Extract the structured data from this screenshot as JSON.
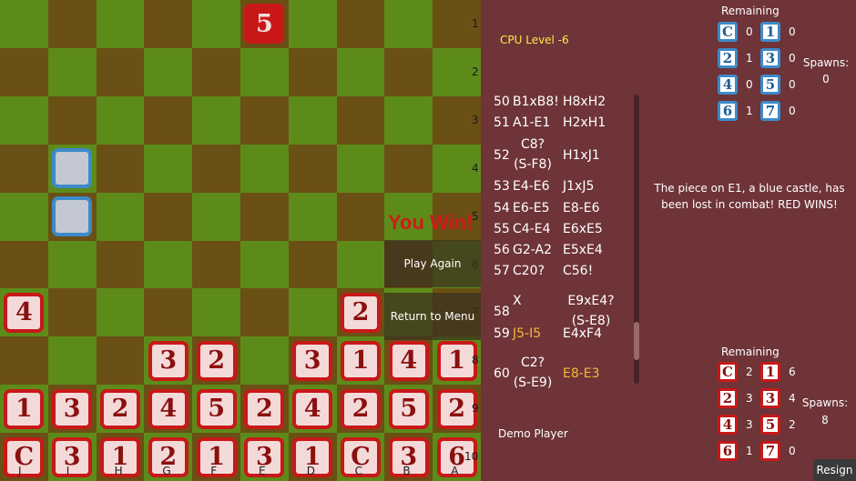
{
  "board": {
    "row_labels": [
      "1",
      "2",
      "3",
      "4",
      "5",
      "6",
      "7",
      "8",
      "9",
      "10"
    ],
    "col_labels": [
      "J",
      "I",
      "H",
      "G",
      "F",
      "E",
      "D",
      "C",
      "B",
      "A"
    ],
    "pieces": [
      {
        "col": 5,
        "row": 0,
        "label": "5",
        "style": "sel"
      },
      {
        "col": 1,
        "row": 3,
        "label": "",
        "style": "blue-empty"
      },
      {
        "col": 1,
        "row": 4,
        "label": "",
        "style": "blue-empty"
      },
      {
        "col": 0,
        "row": 6,
        "label": "4",
        "style": "red"
      },
      {
        "col": 7,
        "row": 6,
        "label": "2",
        "style": "red"
      },
      {
        "col": 3,
        "row": 7,
        "label": "3",
        "style": "red"
      },
      {
        "col": 4,
        "row": 7,
        "label": "2",
        "style": "red"
      },
      {
        "col": 6,
        "row": 7,
        "label": "3",
        "style": "red"
      },
      {
        "col": 7,
        "row": 7,
        "label": "1",
        "style": "red"
      },
      {
        "col": 8,
        "row": 7,
        "label": "4",
        "style": "red"
      },
      {
        "col": 9,
        "row": 7,
        "label": "1",
        "style": "red"
      },
      {
        "col": 0,
        "row": 8,
        "label": "1",
        "style": "red"
      },
      {
        "col": 1,
        "row": 8,
        "label": "3",
        "style": "red"
      },
      {
        "col": 2,
        "row": 8,
        "label": "2",
        "style": "red"
      },
      {
        "col": 3,
        "row": 8,
        "label": "4",
        "style": "red"
      },
      {
        "col": 4,
        "row": 8,
        "label": "5",
        "style": "red"
      },
      {
        "col": 5,
        "row": 8,
        "label": "2",
        "style": "red"
      },
      {
        "col": 6,
        "row": 8,
        "label": "4",
        "style": "red"
      },
      {
        "col": 7,
        "row": 8,
        "label": "2",
        "style": "red"
      },
      {
        "col": 8,
        "row": 8,
        "label": "5",
        "style": "red"
      },
      {
        "col": 9,
        "row": 8,
        "label": "2",
        "style": "red"
      },
      {
        "col": 0,
        "row": 9,
        "label": "C",
        "style": "red"
      },
      {
        "col": 1,
        "row": 9,
        "label": "3",
        "style": "red"
      },
      {
        "col": 2,
        "row": 9,
        "label": "1",
        "style": "red"
      },
      {
        "col": 3,
        "row": 9,
        "label": "2",
        "style": "red"
      },
      {
        "col": 4,
        "row": 9,
        "label": "1",
        "style": "red"
      },
      {
        "col": 5,
        "row": 9,
        "label": "3",
        "style": "red"
      },
      {
        "col": 6,
        "row": 9,
        "label": "1",
        "style": "red"
      },
      {
        "col": 7,
        "row": 9,
        "label": "C",
        "style": "red"
      },
      {
        "col": 8,
        "row": 9,
        "label": "3",
        "style": "red"
      },
      {
        "col": 9,
        "row": 9,
        "label": "6",
        "style": "red"
      }
    ]
  },
  "overlay": {
    "you_win": "You Win!",
    "play_again": "Play Again",
    "return_to_menu": "Return to Menu"
  },
  "left_panel": {
    "cpu_level": "CPU Level -6",
    "demo_player": "Demo Player"
  },
  "moves": [
    {
      "num": "50",
      "a": "B1xB8!",
      "b": "H8xH2"
    },
    {
      "num": "51",
      "a": "A1-E1",
      "b": "H2xH1"
    },
    {
      "num": "52",
      "a": "C8?\n(S-F8)",
      "b": "H1xJ1"
    },
    {
      "num": "53",
      "a": "E4-E6",
      "b": "J1xJ5"
    },
    {
      "num": "54",
      "a": "E6-E5",
      "b": "E8-E6"
    },
    {
      "num": "55",
      "a": "C4-E4",
      "b": "E6xE5"
    },
    {
      "num": "56",
      "a": "G2-A2",
      "b": "E5xE4"
    },
    {
      "num": "57",
      "a": "C20?",
      "b": "C56!"
    },
    {
      "num": "58",
      "a": "X",
      "b": "E9xE4?\n(S-E8)"
    },
    {
      "num": "59",
      "a": "J5-I5",
      "b": "E4xF4"
    },
    {
      "num": "60",
      "a": "C2?\n(S-E9)",
      "b": "E8-E3"
    }
  ],
  "blue_remaining": {
    "title": "Remaining",
    "items": [
      {
        "label": "C",
        "count": "0"
      },
      {
        "label": "1",
        "count": "0"
      },
      {
        "label": "2",
        "count": "1"
      },
      {
        "label": "3",
        "count": "0"
      },
      {
        "label": "4",
        "count": "0"
      },
      {
        "label": "5",
        "count": "0"
      },
      {
        "label": "6",
        "count": "1"
      },
      {
        "label": "7",
        "count": "0"
      }
    ],
    "spawns_label": "Spawns:",
    "spawns_value": "0"
  },
  "red_remaining": {
    "title": "Remaining",
    "items": [
      {
        "label": "C",
        "count": "2"
      },
      {
        "label": "1",
        "count": "6"
      },
      {
        "label": "2",
        "count": "3"
      },
      {
        "label": "3",
        "count": "4"
      },
      {
        "label": "4",
        "count": "3"
      },
      {
        "label": "5",
        "count": "2"
      },
      {
        "label": "6",
        "count": "1"
      },
      {
        "label": "7",
        "count": "0"
      }
    ],
    "spawns_label": "Spawns:",
    "spawns_value": "8"
  },
  "message": "The piece on E1, a blue castle, has been lost in combat! RED WINS!",
  "resign": "Resign",
  "colors": {
    "light_square": "#5d8b1a",
    "dark_square": "#6a5014",
    "red_piece_border": "#c81818",
    "blue_piece_border": "#3d8ac9",
    "panel_bg": "#6e3438",
    "highlight": "#f7b83a",
    "cpu_level": "#ffe84a"
  }
}
